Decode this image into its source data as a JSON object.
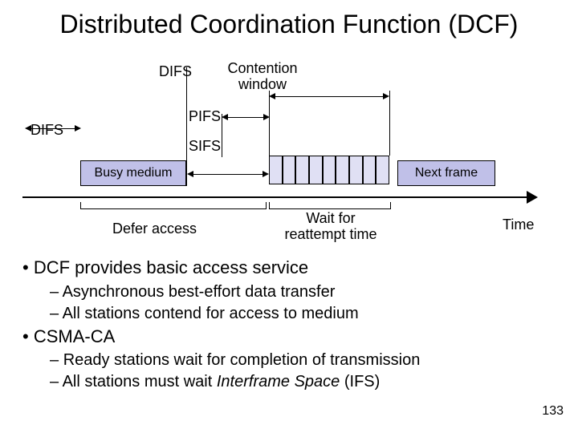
{
  "title": "Distributed Coordination Function (DCF)",
  "diagram": {
    "difs_top": "DIFS",
    "contention": "Contention window",
    "pifs": "PIFS",
    "sifs": "SIFS",
    "difs_left": "DIFS",
    "busy": "Busy medium",
    "next": "Next frame",
    "defer": "Defer access",
    "wait": "Wait for reattempt time",
    "time": "Time",
    "slot_count": 9
  },
  "bullets": [
    {
      "level": 1,
      "text": "DCF provides basic access service"
    },
    {
      "level": 2,
      "text": "Asynchronous best-effort data transfer"
    },
    {
      "level": 2,
      "text": "All stations contend for access to medium"
    },
    {
      "level": 1,
      "text": "CSMA-CA"
    },
    {
      "level": 2,
      "text": "Ready stations wait for completion of transmission"
    },
    {
      "level": 2,
      "text": "All stations must wait Interframe Space (IFS)",
      "italic": "Interframe Space"
    }
  ],
  "page_number": "133"
}
